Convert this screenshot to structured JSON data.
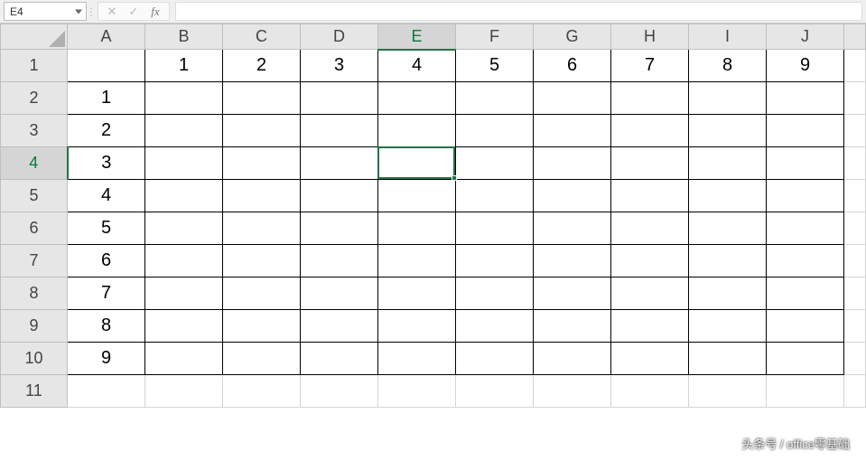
{
  "formulaBar": {
    "nameBox": "E4",
    "cancelGlyph": "✕",
    "confirmGlyph": "✓",
    "fxLabel": "fx",
    "input": ""
  },
  "columns": [
    "A",
    "B",
    "C",
    "D",
    "E",
    "F",
    "G",
    "H",
    "I",
    "J"
  ],
  "rows": [
    "1",
    "2",
    "3",
    "4",
    "5",
    "6",
    "7",
    "8",
    "9",
    "10",
    "11"
  ],
  "selectedCol": "E",
  "selectedRow": "4",
  "cells": {
    "B1": "1",
    "C1": "2",
    "D1": "3",
    "E1": "4",
    "F1": "5",
    "G1": "6",
    "H1": "7",
    "I1": "8",
    "J1": "9",
    "A2": "1",
    "A3": "2",
    "A4": "3",
    "A5": "4",
    "A6": "5",
    "A7": "6",
    "A8": "7",
    "A9": "8",
    "A10": "9"
  },
  "watermark": "头条号 / office零基础"
}
